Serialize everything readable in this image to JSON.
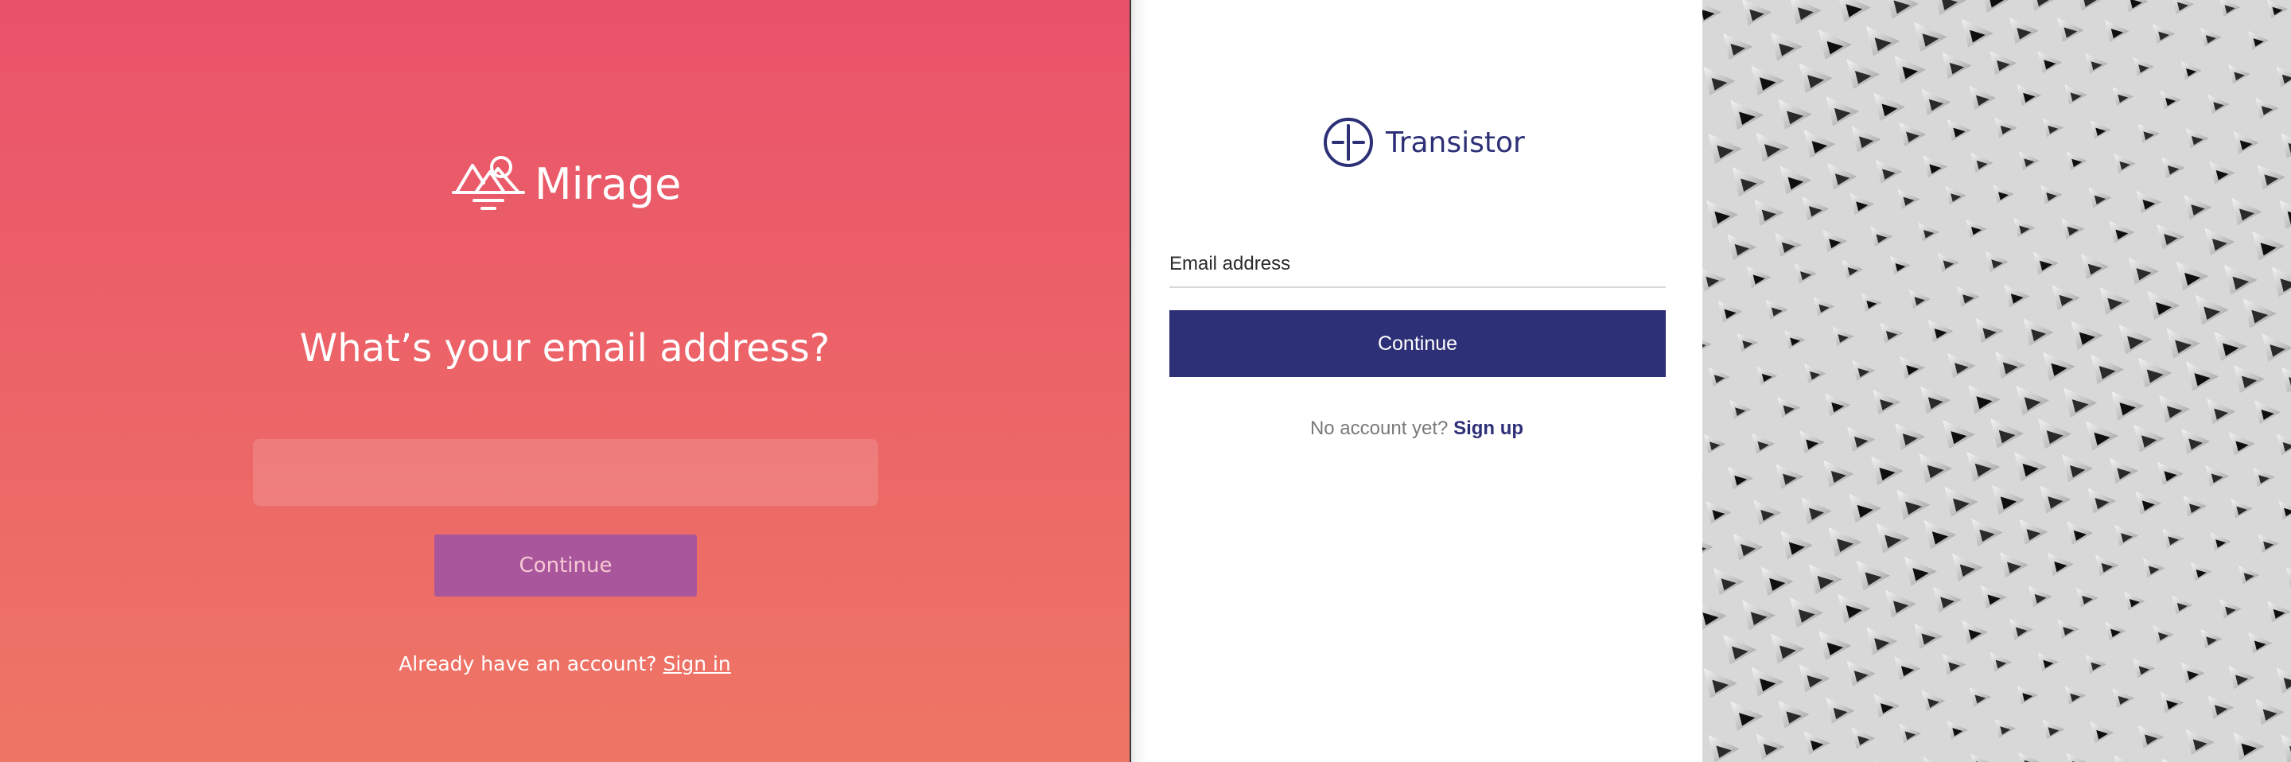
{
  "mirage": {
    "brand": "Mirage",
    "heading": "What’s your email address?",
    "email_value": "",
    "continue_label": "Continue",
    "footer_prompt": "Already have an account? ",
    "footer_link": "Sign in",
    "colors": {
      "gradient_top": "#e9526a",
      "gradient_bottom": "#ee7665",
      "button": "#a9569c"
    },
    "icon": "mirage-mountain-logo-icon"
  },
  "transistor": {
    "brand": "Transistor",
    "email_label": "Email address",
    "email_value": "",
    "continue_label": "Continue",
    "footer_prompt": "No account yet? ",
    "footer_link": "Sign up",
    "colors": {
      "brand": "#2e3077",
      "button": "#2e3077"
    },
    "icon": "transistor-logo-icon"
  },
  "photo": {
    "description_icon": "architectural-pattern-image"
  }
}
